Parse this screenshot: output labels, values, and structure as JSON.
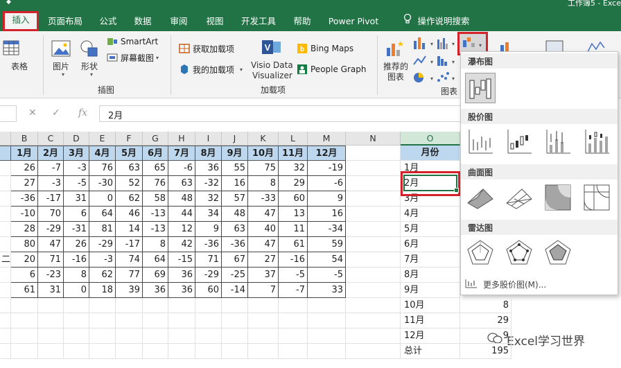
{
  "window": {
    "title_fragment": "工作簿5  -  Exce"
  },
  "tabs": [
    {
      "label": "插入",
      "active": true
    },
    {
      "label": "页面布局"
    },
    {
      "label": "公式"
    },
    {
      "label": "数据"
    },
    {
      "label": "审阅"
    },
    {
      "label": "视图"
    },
    {
      "label": "开发工具"
    },
    {
      "label": "帮助"
    },
    {
      "label": "Power Pivot"
    },
    {
      "label": "操作说明搜索"
    }
  ],
  "ribbon": {
    "table_label": "表格",
    "picture_label": "图片",
    "shapes_label": "形状",
    "smartart_label": "SmartArt",
    "screenshot_label": "屏幕截图",
    "group_illustrations": "插图",
    "get_addins_label": "获取加载项",
    "my_addins_label": "我的加载项",
    "visio_label_1": "Visio Data",
    "visio_label_2": "Visualizer",
    "bing_maps_label": "Bing Maps",
    "people_graph_label": "People Graph",
    "group_addins": "加载项",
    "recommended_charts_1": "推荐的",
    "recommended_charts_2": "图表",
    "group_charts": "图表"
  },
  "formula_bar": {
    "value": "2月",
    "fx": "fx"
  },
  "columns": [
    "B",
    "C",
    "D",
    "E",
    "F",
    "G",
    "H",
    "I",
    "J",
    "K",
    "L",
    "M",
    "N",
    "O"
  ],
  "table": {
    "header": [
      "1月",
      "2月",
      "3月",
      "4月",
      "5月",
      "6月",
      "7月",
      "8月",
      "9月",
      "10月",
      "11月",
      "12月"
    ],
    "row_tail_char": "二",
    "rows": [
      [
        26,
        -7,
        -3,
        76,
        63,
        65,
        -6,
        36,
        55,
        75,
        32,
        -19
      ],
      [
        27,
        -3,
        -5,
        -30,
        52,
        76,
        63,
        -32,
        16,
        8,
        29,
        -6
      ],
      [
        -36,
        -17,
        31,
        0,
        62,
        58,
        48,
        32,
        57,
        -33,
        60,
        9
      ],
      [
        -10,
        70,
        6,
        64,
        46,
        -13,
        44,
        34,
        48,
        47,
        13,
        16
      ],
      [
        28,
        -29,
        -31,
        81,
        14,
        -13,
        12,
        9,
        63,
        40,
        11,
        -34
      ],
      [
        80,
        47,
        26,
        -29,
        -17,
        8,
        42,
        -36,
        -36,
        47,
        61,
        59
      ],
      [
        20,
        71,
        -16,
        -3,
        74,
        64,
        -15,
        71,
        67,
        27,
        -16,
        54
      ],
      [
        6,
        -23,
        8,
        62,
        77,
        69,
        36,
        -29,
        -25,
        37,
        -5,
        -5
      ],
      [
        61,
        31,
        0,
        18,
        39,
        36,
        36,
        60,
        -14,
        7,
        -7,
        33
      ]
    ]
  },
  "month_column": {
    "header": "月份",
    "items": [
      "1月",
      "2月",
      "3月",
      "4月",
      "5月",
      "6月",
      "7月",
      "8月",
      "9月",
      "10月",
      "11月",
      "12月",
      "总计"
    ],
    "values": [
      "",
      "",
      "",
      "",
      "",
      "",
      "",
      "",
      "",
      "8",
      "29",
      "9",
      "195"
    ]
  },
  "chart_menu": {
    "waterfall_title": "瀑布图",
    "stock_title": "股价图",
    "surface_title": "曲面图",
    "radar_title": "雷达图",
    "more_label": "更多股价图(M)..."
  },
  "watermark": "Excel学习世界",
  "colors": {
    "excel_green": "#217346",
    "highlight_red": "#d4222a",
    "header_blue": "#bdd7ee"
  }
}
